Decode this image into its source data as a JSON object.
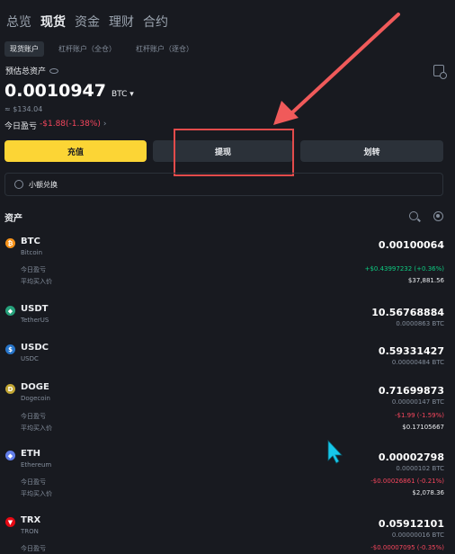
{
  "top_tabs": [
    "总览",
    "现货",
    "资金",
    "理财",
    "合约"
  ],
  "active_top_tab": 1,
  "sub_tabs": [
    "现货账户",
    "杠杆账户（全仓）",
    "杠杆账户（逐仓）"
  ],
  "overview": {
    "label": "预估总资产",
    "balance": "0.0010947",
    "unit": "BTC ▾",
    "approx": "≈ $134.04",
    "pnl_label": "今日盈亏",
    "pnl_value": "-$1.88(-1.38%)",
    "pnl_arrow": "›"
  },
  "actions": {
    "deposit": "充值",
    "withdraw": "提现",
    "transfer": "划转"
  },
  "exchange_label": "小额兑换",
  "assets_title": "资产",
  "row_labels": {
    "pnl": "今日盈亏",
    "avg_price": "平均买入价"
  },
  "coins": [
    {
      "symbol": "BTC",
      "name": "Bitcoin",
      "amount": "0.00100064",
      "btc": "",
      "pnl": "+$0.43997232 (+0.36%)",
      "pnl_sign": "pos",
      "avg": "$37,881.56",
      "icon_color": "#f7931a",
      "icon_glyph": "₿"
    },
    {
      "symbol": "USDT",
      "name": "TetherUS",
      "amount": "10.56768884",
      "btc": "0.0000863 BTC",
      "icon_color": "#26a17b",
      "icon_glyph": "◆"
    },
    {
      "symbol": "USDC",
      "name": "USDC",
      "amount": "0.59331427",
      "btc": "0.00000484 BTC",
      "icon_color": "#2775ca",
      "icon_glyph": "$"
    },
    {
      "symbol": "DOGE",
      "name": "Dogecoin",
      "amount": "0.71699873",
      "btc": "0.00000147 BTC",
      "pnl": "-$1.99 (-1.59%)",
      "pnl_sign": "neg",
      "avg": "$0.17105667",
      "icon_color": "#c2a633",
      "icon_glyph": "D"
    },
    {
      "symbol": "ETH",
      "name": "Ethereum",
      "amount": "0.00002798",
      "btc": "0.0000102 BTC",
      "pnl": "-$0.00026861 (-0.21%)",
      "pnl_sign": "neg",
      "avg": "$2,078.36",
      "icon_color": "#627eea",
      "icon_glyph": "◆"
    },
    {
      "symbol": "TRX",
      "name": "TRON",
      "amount": "0.05912101",
      "btc": "0.00000016 BTC",
      "pnl": "-$0.00007095 (-0.35%)",
      "pnl_sign": "neg",
      "avg": "",
      "icon_color": "#e50914",
      "icon_glyph": "▼"
    }
  ]
}
